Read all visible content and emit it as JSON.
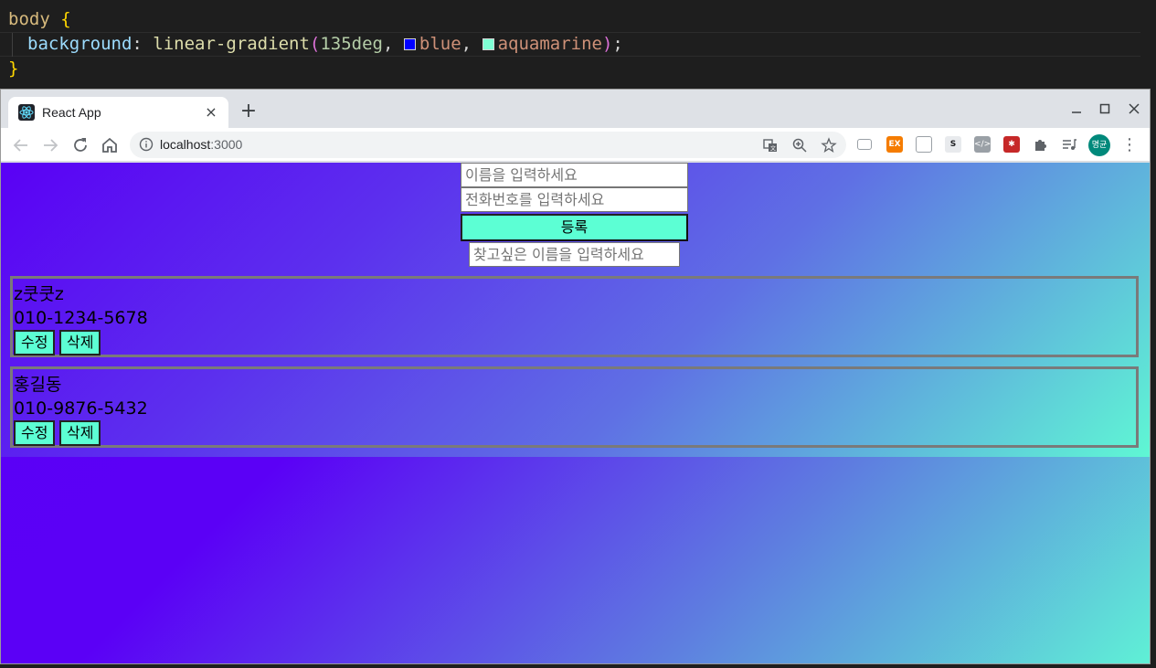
{
  "editor": {
    "selector": "body",
    "open_brace": "{",
    "close_brace": "}",
    "property": "background",
    "colon": ":",
    "function": "linear-gradient",
    "angle": "135deg",
    "comma": ",",
    "color1": "blue",
    "color2": "aquamarine",
    "semicolon": ";",
    "swatch_color1": "#0000ff",
    "swatch_color2": "#7fffd4"
  },
  "browser": {
    "tab_title": "React App",
    "tab_close": "×",
    "new_tab": "+",
    "url_host": "localhost",
    "url_port": ":3000",
    "avatar_text": "명균",
    "icons": {
      "back": "arrow-left-icon",
      "forward": "arrow-right-icon",
      "reload": "reload-icon",
      "home": "home-icon",
      "info": "info-icon",
      "translate": "translate-icon",
      "zoom": "zoom-icon",
      "bookmark": "star-icon",
      "extensions": "puzzle-icon",
      "media": "media-control-icon",
      "menu": "kebab-menu-icon"
    }
  },
  "app": {
    "name_placeholder": "이름을 입력하세요",
    "phone_placeholder": "전화번호를 입력하세요",
    "register_label": "등록",
    "search_placeholder": "찾고싶은 이름을 입력하세요",
    "contacts": [
      {
        "name": "z쿳쿳z",
        "phone": "010-1234-5678",
        "edit_label": "수정",
        "delete_label": "삭제"
      },
      {
        "name": "홍길동",
        "phone": "010-9876-5432",
        "edit_label": "수정",
        "delete_label": "삭제"
      }
    ],
    "colors": {
      "gradient_start": "#0000ff",
      "gradient_end": "#7fffd4",
      "button_bg": "#5cffd4"
    }
  }
}
